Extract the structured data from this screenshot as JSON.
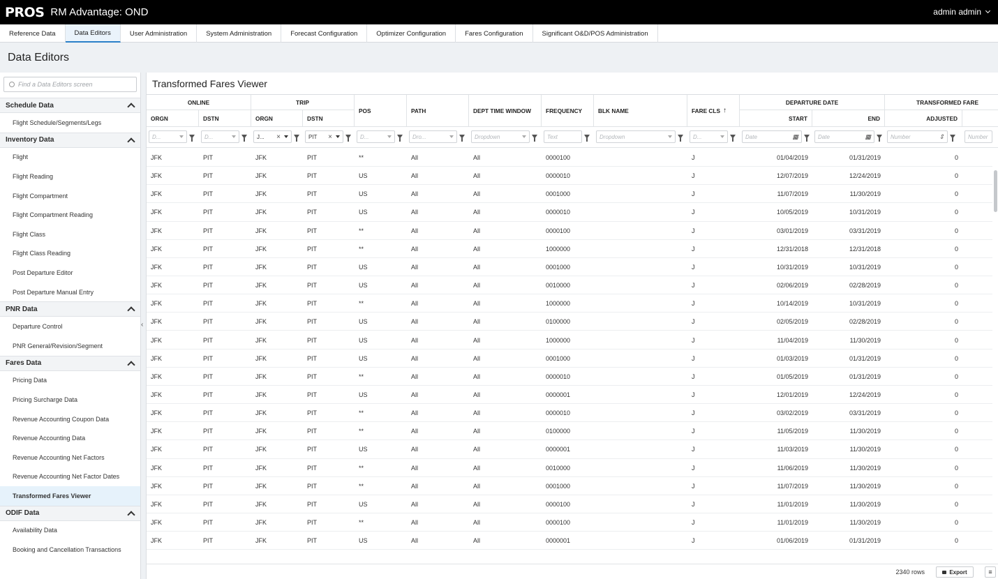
{
  "app": {
    "logo": "PROS",
    "title": "RM Advantage: OND",
    "user": "admin admin"
  },
  "nav": {
    "tabs": [
      {
        "label": "Reference Data",
        "active": false
      },
      {
        "label": "Data Editors",
        "active": true
      },
      {
        "label": "User Administration",
        "active": false
      },
      {
        "label": "System Administration",
        "active": false
      },
      {
        "label": "Forecast Configuration",
        "active": false
      },
      {
        "label": "Optimizer Configuration",
        "active": false
      },
      {
        "label": "Fares Configuration",
        "active": false
      },
      {
        "label": "Significant O&D/POS Administration",
        "active": false
      }
    ]
  },
  "page": {
    "title": "Data Editors"
  },
  "sidebar": {
    "search_placeholder": "Find a Data Editors screen",
    "sections": [
      {
        "title": "Schedule Data",
        "items": [
          "Flight Schedule/Segments/Legs"
        ]
      },
      {
        "title": "Inventory Data",
        "items": [
          "Flight",
          "Flight Reading",
          "Flight Compartment",
          "Flight Compartment Reading",
          "Flight Class",
          "Flight Class Reading",
          "Post Departure Editor",
          "Post Departure Manual Entry"
        ]
      },
      {
        "title": "PNR Data",
        "items": [
          "Departure Control",
          "PNR General/Revision/Segment"
        ]
      },
      {
        "title": "Fares Data",
        "items": [
          "Pricing Data",
          "Pricing Surcharge Data",
          "Revenue Accounting Coupon Data",
          "Revenue Accounting Data",
          "Revenue Accounting Net Factors",
          "Revenue Accounting Net Factor Dates",
          "Transformed Fares Viewer"
        ]
      },
      {
        "title": "ODIF Data",
        "items": [
          "Availability Data",
          "Booking and Cancellation Transactions"
        ]
      }
    ],
    "active_item": "Transformed Fares Viewer"
  },
  "main": {
    "title": "Transformed Fares Viewer"
  },
  "grid": {
    "groups": {
      "online": "ONLINE",
      "trip": "TRIP",
      "departure_date": "DEPARTURE DATE",
      "transformed_fare": "TRANSFORMED FARE"
    },
    "headers": {
      "orgn": "ORGN",
      "dstn": "DSTN",
      "trip_orgn": "ORGN",
      "trip_dstn": "DSTN",
      "pos": "POS",
      "path": "PATH",
      "dept_time_window": "DEPT TIME WINDOW",
      "frequency": "FREQUENCY",
      "blk_name": "BLK NAME",
      "fare_cls": "FARE CLS",
      "start": "START",
      "end": "END",
      "adjusted": "ADJUSTED"
    },
    "sort_icon": "arrow-up-icon",
    "filters": {
      "orgn": "D...",
      "dstn": "D...",
      "trip_orgn": "J...",
      "trip_dstn": "PIT",
      "pos": "D...",
      "path": "Dro...",
      "dept_time_window": "Dropdown",
      "frequency": "Text",
      "blk_name": "Dropdown",
      "fare_cls": "D...",
      "start": "Date",
      "end": "Date",
      "adjusted": "Number",
      "next": "Number"
    },
    "rows": [
      [
        "JFK",
        "PIT",
        "JFK",
        "PIT",
        "**",
        "All",
        "All",
        "0000100",
        "",
        "J",
        "01/04/2019",
        "01/31/2019",
        "0"
      ],
      [
        "JFK",
        "PIT",
        "JFK",
        "PIT",
        "US",
        "All",
        "All",
        "0000010",
        "",
        "J",
        "12/07/2019",
        "12/24/2019",
        "0"
      ],
      [
        "JFK",
        "PIT",
        "JFK",
        "PIT",
        "US",
        "All",
        "All",
        "0001000",
        "",
        "J",
        "11/07/2019",
        "11/30/2019",
        "0"
      ],
      [
        "JFK",
        "PIT",
        "JFK",
        "PIT",
        "US",
        "All",
        "All",
        "0000010",
        "",
        "J",
        "10/05/2019",
        "10/31/2019",
        "0"
      ],
      [
        "JFK",
        "PIT",
        "JFK",
        "PIT",
        "**",
        "All",
        "All",
        "0000100",
        "",
        "J",
        "03/01/2019",
        "03/31/2019",
        "0"
      ],
      [
        "JFK",
        "PIT",
        "JFK",
        "PIT",
        "**",
        "All",
        "All",
        "1000000",
        "",
        "J",
        "12/31/2018",
        "12/31/2018",
        "0"
      ],
      [
        "JFK",
        "PIT",
        "JFK",
        "PIT",
        "US",
        "All",
        "All",
        "0001000",
        "",
        "J",
        "10/31/2019",
        "10/31/2019",
        "0"
      ],
      [
        "JFK",
        "PIT",
        "JFK",
        "PIT",
        "US",
        "All",
        "All",
        "0010000",
        "",
        "J",
        "02/06/2019",
        "02/28/2019",
        "0"
      ],
      [
        "JFK",
        "PIT",
        "JFK",
        "PIT",
        "**",
        "All",
        "All",
        "1000000",
        "",
        "J",
        "10/14/2019",
        "10/31/2019",
        "0"
      ],
      [
        "JFK",
        "PIT",
        "JFK",
        "PIT",
        "US",
        "All",
        "All",
        "0100000",
        "",
        "J",
        "02/05/2019",
        "02/28/2019",
        "0"
      ],
      [
        "JFK",
        "PIT",
        "JFK",
        "PIT",
        "US",
        "All",
        "All",
        "1000000",
        "",
        "J",
        "11/04/2019",
        "11/30/2019",
        "0"
      ],
      [
        "JFK",
        "PIT",
        "JFK",
        "PIT",
        "US",
        "All",
        "All",
        "0001000",
        "",
        "J",
        "01/03/2019",
        "01/31/2019",
        "0"
      ],
      [
        "JFK",
        "PIT",
        "JFK",
        "PIT",
        "**",
        "All",
        "All",
        "0000010",
        "",
        "J",
        "01/05/2019",
        "01/31/2019",
        "0"
      ],
      [
        "JFK",
        "PIT",
        "JFK",
        "PIT",
        "US",
        "All",
        "All",
        "0000001",
        "",
        "J",
        "12/01/2019",
        "12/24/2019",
        "0"
      ],
      [
        "JFK",
        "PIT",
        "JFK",
        "PIT",
        "**",
        "All",
        "All",
        "0000010",
        "",
        "J",
        "03/02/2019",
        "03/31/2019",
        "0"
      ],
      [
        "JFK",
        "PIT",
        "JFK",
        "PIT",
        "**",
        "All",
        "All",
        "0100000",
        "",
        "J",
        "11/05/2019",
        "11/30/2019",
        "0"
      ],
      [
        "JFK",
        "PIT",
        "JFK",
        "PIT",
        "US",
        "All",
        "All",
        "0000001",
        "",
        "J",
        "11/03/2019",
        "11/30/2019",
        "0"
      ],
      [
        "JFK",
        "PIT",
        "JFK",
        "PIT",
        "**",
        "All",
        "All",
        "0010000",
        "",
        "J",
        "11/06/2019",
        "11/30/2019",
        "0"
      ],
      [
        "JFK",
        "PIT",
        "JFK",
        "PIT",
        "**",
        "All",
        "All",
        "0001000",
        "",
        "J",
        "11/07/2019",
        "11/30/2019",
        "0"
      ],
      [
        "JFK",
        "PIT",
        "JFK",
        "PIT",
        "US",
        "All",
        "All",
        "0000100",
        "",
        "J",
        "11/01/2019",
        "11/30/2019",
        "0"
      ],
      [
        "JFK",
        "PIT",
        "JFK",
        "PIT",
        "**",
        "All",
        "All",
        "0000100",
        "",
        "J",
        "11/01/2019",
        "11/30/2019",
        "0"
      ],
      [
        "JFK",
        "PIT",
        "JFK",
        "PIT",
        "US",
        "All",
        "All",
        "0000001",
        "",
        "J",
        "01/06/2019",
        "01/31/2019",
        "0"
      ]
    ],
    "row_count": "2340 rows",
    "export_label": "Export"
  },
  "colors": {
    "topbar": "#000000",
    "active_tab": "#eaf3fb",
    "accent": "#2a7fc8"
  }
}
